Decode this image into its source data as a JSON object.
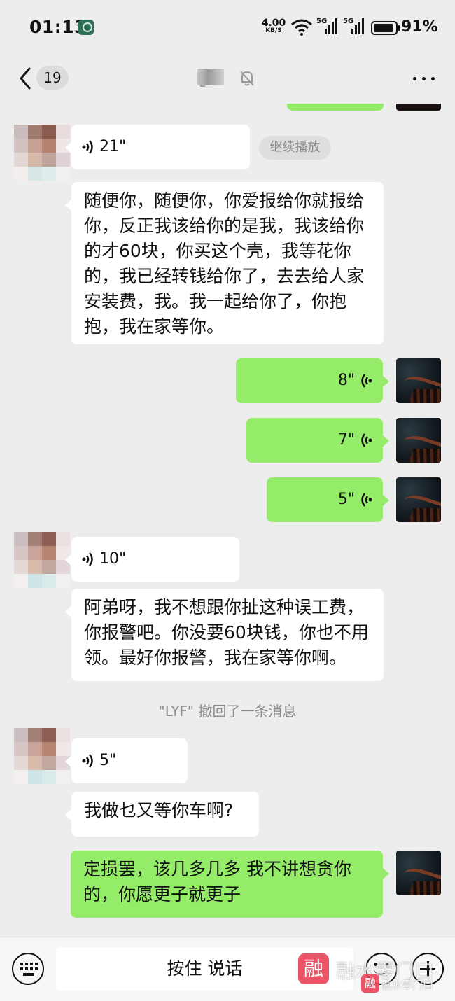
{
  "status_bar": {
    "time": "01:13",
    "net_speed_value": "4.00",
    "net_speed_unit": "KB/S",
    "sig1": "5G",
    "sig2": "5G",
    "battery_pct": "91%"
  },
  "nav": {
    "back_count": "19",
    "title": "_",
    "icon_back": "back-chevron-icon",
    "icon_mute": "mute-bell-icon",
    "icon_more": "more-dots-icon"
  },
  "messages": [
    {
      "from": "contact",
      "type": "voice",
      "duration": "21\""
    },
    {
      "from": "contact",
      "type": "text",
      "text": "随便你，随便你，你爱报给你就报给你，反正我该给你的是我，我该给你的才60块，你买这个壳，我等花你的，我已经转钱给你了，去去给人家安装费，我。我一起给你了，你抱抱，我在家等你。"
    },
    {
      "from": "me",
      "type": "voice",
      "duration": "8\""
    },
    {
      "from": "me",
      "type": "voice",
      "duration": "7\""
    },
    {
      "from": "me",
      "type": "voice",
      "duration": "5\""
    },
    {
      "from": "contact",
      "type": "voice",
      "duration": "10\""
    },
    {
      "from": "contact",
      "type": "text",
      "text": "阿弟呀，我不想跟你扯这种误工费，你报警吧。你没要60块钱，你也不用领。最好你报警，我在家等你啊。"
    },
    {
      "from": "contact",
      "type": "voice",
      "duration": "5\""
    },
    {
      "from": "contact",
      "type": "text",
      "text": "我做乜又等你车啊?"
    },
    {
      "from": "me",
      "type": "text",
      "text": "定损罢，该几多几多 我不讲想贪你的，你愿更子就更子"
    }
  ],
  "resume_button": "继续播放",
  "system_message": "\"LYF\" 撤回了一条消息",
  "input_bar": {
    "hold_to_talk": "按住 说话",
    "icons": [
      "keyboard-icon",
      "emoji-icon",
      "plus-icon"
    ]
  },
  "watermark": {
    "logo": "融",
    "text": "融水零门口",
    "small_text": "融水零门口"
  },
  "colors": {
    "background": "#ededed",
    "incoming_bubble": "#ffffff",
    "outgoing_bubble": "#95ec69",
    "system_text": "#8a8a8a"
  }
}
